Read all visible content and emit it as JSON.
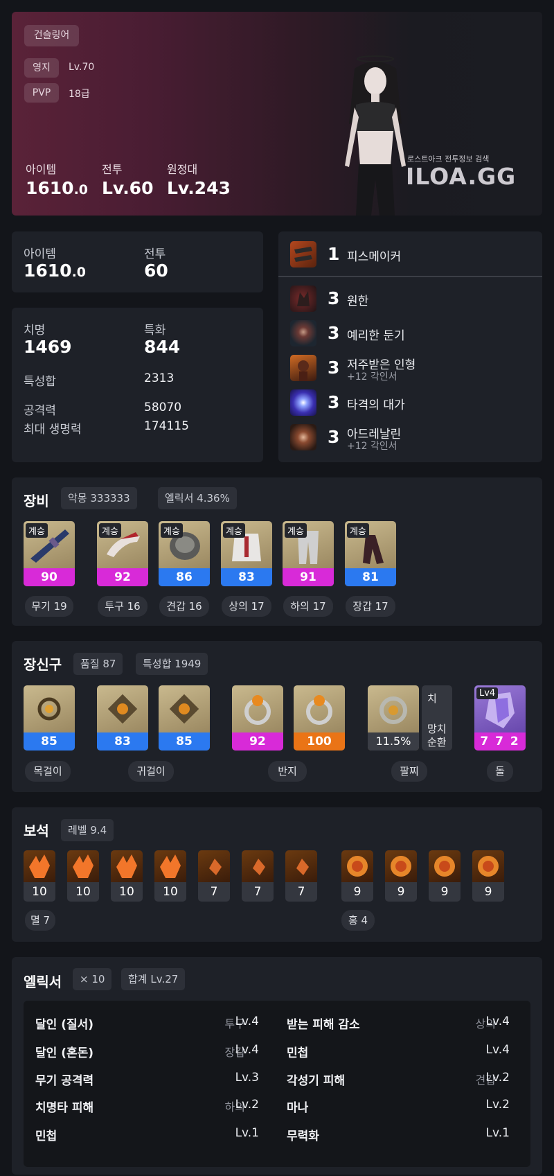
{
  "hero": {
    "class": "건슬링어",
    "tags": [
      {
        "k": "영지",
        "v": "Lv.70"
      },
      {
        "k": "PVP",
        "v": "18급"
      }
    ],
    "stats": [
      {
        "label": "아이템",
        "value": "1610",
        "suffix": ".0"
      },
      {
        "label": "전투",
        "value": "Lv.60",
        "suffix": ""
      },
      {
        "label": "원정대",
        "value": "Lv.243",
        "suffix": ""
      }
    ],
    "watermark_small": "로스트아크 전투정보 검색",
    "watermark_big": "ILOA.GG"
  },
  "summary": {
    "item_label": "아이템",
    "item_value": "1610",
    "item_suffix": ".0",
    "combat_label": "전투",
    "combat_value": "60"
  },
  "stats": {
    "crit_label": "치명",
    "crit_value": "1469",
    "spec_label": "특화",
    "spec_value": "844",
    "total_label": "특성합",
    "total_value": "2313",
    "atk_label": "공격력",
    "atk_value": "58070",
    "hp_label": "최대 생명력",
    "hp_value": "174115"
  },
  "engravings": {
    "class_engraving": {
      "level": "1",
      "name": "피스메이커"
    },
    "items": [
      {
        "level": "3",
        "name": "원한",
        "sub": ""
      },
      {
        "level": "3",
        "name": "예리한 둔기",
        "sub": ""
      },
      {
        "level": "3",
        "name": "저주받은 인형",
        "sub": "+12 각인서"
      },
      {
        "level": "3",
        "name": "타격의 대가",
        "sub": ""
      },
      {
        "level": "3",
        "name": "아드레날린",
        "sub": "+12 각인서"
      }
    ]
  },
  "equipment": {
    "title": "장비",
    "pills": [
      "악몽 333333",
      "엘릭서 4.36%"
    ],
    "items": [
      {
        "badge": "계승",
        "quality": "90",
        "name": "무기 19",
        "color": "#d82ad8"
      },
      {
        "badge": "계승",
        "quality": "92",
        "name": "투구 16",
        "color": "#d82ad8"
      },
      {
        "badge": "계승",
        "quality": "86",
        "name": "견갑 16",
        "color": "#2b79f0"
      },
      {
        "badge": "계승",
        "quality": "83",
        "name": "상의 17",
        "color": "#2b79f0"
      },
      {
        "badge": "계승",
        "quality": "91",
        "name": "하의 17",
        "color": "#d82ad8"
      },
      {
        "badge": "계승",
        "quality": "81",
        "name": "장갑 17",
        "color": "#2b79f0"
      }
    ]
  },
  "accessories": {
    "title": "장신구",
    "pills": [
      "품질 87",
      "특성합 1949"
    ],
    "items": [
      {
        "quality": "85"
      },
      {
        "quality": "83"
      },
      {
        "quality": "85"
      },
      {
        "quality": "92"
      },
      {
        "quality": "100"
      }
    ],
    "bracelet": {
      "value": "11.5%",
      "opts": [
        "치",
        "망치",
        "순환"
      ]
    },
    "stone": {
      "badge": "Lv4",
      "value": "7 7 2"
    },
    "labels": [
      "목걸이",
      "귀걸이",
      "반지",
      "팔찌",
      "돌"
    ]
  },
  "gems": {
    "title": "보석",
    "level_pill": "레벨 9.4",
    "annihilation": [
      "10",
      "10",
      "10",
      "10",
      "7",
      "7",
      "7"
    ],
    "crimson": [
      "9",
      "9",
      "9",
      "9"
    ],
    "label_left": "멸 7",
    "label_right": "홍 4"
  },
  "elixir": {
    "title": "엘릭서",
    "pills": [
      "× 10",
      "합계 Lv.27"
    ],
    "left": [
      {
        "name": "달인 (질서)",
        "part": "투구",
        "lv": "Lv.4"
      },
      {
        "name": "달인 (혼돈)",
        "part": "장갑",
        "lv": "Lv.4"
      },
      {
        "name": "무기 공격력",
        "part": "",
        "lv": "Lv.3"
      },
      {
        "name": "치명타 피해",
        "part": "하의",
        "lv": "Lv.2"
      },
      {
        "name": "민첩",
        "part": "",
        "lv": "Lv.1"
      }
    ],
    "right": [
      {
        "name": "받는 피해 감소",
        "part": "상의",
        "lv": "Lv.4"
      },
      {
        "name": "민첩",
        "part": "",
        "lv": "Lv.4"
      },
      {
        "name": "각성기 피해",
        "part": "견갑",
        "lv": "Lv.2"
      },
      {
        "name": "마나",
        "part": "",
        "lv": "Lv.2"
      },
      {
        "name": "무력화",
        "part": "",
        "lv": "Lv.1"
      }
    ]
  }
}
